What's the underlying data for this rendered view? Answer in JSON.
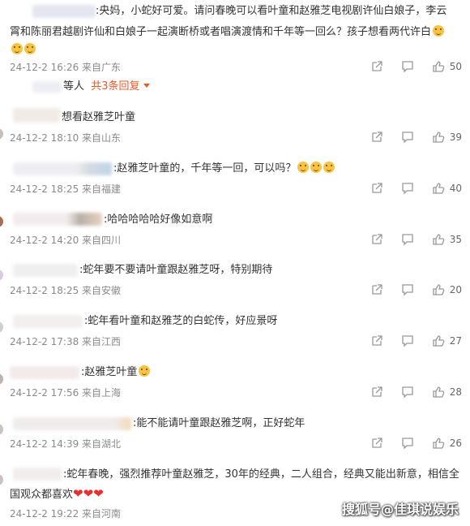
{
  "top_comment": {
    "line1": ":央妈，小蛇好可爱。请问春晚可以看叶童和赵雅芝电视剧许仙白娘子，李云",
    "line2": "霄和陈丽君越剧许仙和白娘子一起演断桥或者唱演渡情和千年等一回么？孩子想看两代许白",
    "time": "24-12-2 16:26 来自广东",
    "likes": "50"
  },
  "reply_summary": {
    "label": "等人",
    "count_text": "共3条回复"
  },
  "comments": [
    {
      "text": "想看赵雅芝叶童",
      "time": "24-12-2 18:10 来自山东",
      "likes": "39"
    },
    {
      "text": ":赵雅芝叶童的，千年等一回，可以吗？",
      "time": "24-12-2 18:25 来自福建",
      "likes": "40"
    },
    {
      "text": ":哈哈哈哈哈好像如意啊",
      "time": "24-12-2 14:20 来自四川",
      "likes": "35"
    },
    {
      "text": ":蛇年要不要请叶童跟赵雅芝呀，特别期待",
      "time": "24-12-2 18:25 来自安徽",
      "likes": "20"
    },
    {
      "text": ":蛇年看叶童和赵雅芝的白蛇传，好应景呀",
      "time": "24-12-2 17:38 来自江西",
      "likes": "27"
    },
    {
      "text": ":赵雅芝叶童",
      "time": "24-12-2 17:56 来自上海",
      "likes": "28"
    },
    {
      "text": ":能不能请叶童跟赵雅芝啊，正好蛇年",
      "time": "24-12-2 14:39 来自湖北",
      "likes": "26"
    },
    {
      "text1": ":蛇年春晚，强烈推荐叶童赵雅芝，30年的经典，二人组合，经典又能出新意，相信全",
      "text2": "国观众都喜欢",
      "time": "24-12-2 19:22 来自河南",
      "likes": ""
    }
  ],
  "watermark": "搜狐号@佳琪说娱乐",
  "icons": [
    "share-icon",
    "comment-icon",
    "like-icon",
    "emoji-icon",
    "heart-icon"
  ]
}
